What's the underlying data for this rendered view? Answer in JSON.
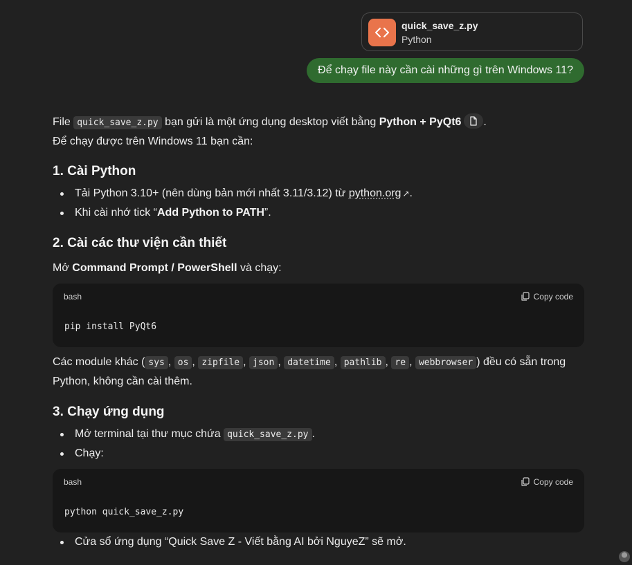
{
  "attachment": {
    "name": "quick_save_z.py",
    "type": "Python",
    "icon": "code-icon",
    "color": "#e9744b"
  },
  "user_message": "Để chạy file này cần cài những gì trên Windows 11?",
  "response": {
    "intro": {
      "p1_before": "File ",
      "p1_code": "quick_save_z.py",
      "p1_mid": " bạn gửi là một ứng dụng desktop viết bằng ",
      "p1_bold": "Python + PyQt6",
      "p1_after": ".",
      "p2": "Để chạy được trên Windows 11 bạn cần:"
    },
    "section1": {
      "title": "1. Cài Python",
      "item1_before": "Tải Python 3.10+ (nên dùng bản mới nhất 3.11/3.12) từ ",
      "item1_link": "python.org",
      "item1_arrow": "↗",
      "item1_after": ".",
      "item2_before": "Khi cài nhớ tick “",
      "item2_bold": "Add Python to PATH",
      "item2_after": "”."
    },
    "section2": {
      "title": "2. Cài các thư viện cần thiết",
      "intro_before": "Mở ",
      "intro_bold": "Command Prompt / PowerShell",
      "intro_after": " và chạy:",
      "code_lang": "bash",
      "code_copy": "Copy code",
      "code": "pip install PyQt6",
      "modules_before": "Các module khác (",
      "modules": [
        "sys",
        "os",
        "zipfile",
        "json",
        "datetime",
        "pathlib",
        "re",
        "webbrowser"
      ],
      "modules_after": ") đều có sẵn trong",
      "modules_line2": "Python, không cần cài thêm."
    },
    "section3": {
      "title": "3. Chạy ứng dụng",
      "item1_before": "Mở terminal tại thư mục chứa ",
      "item1_code": "quick_save_z.py",
      "item1_after": ".",
      "item2": "Chạy:",
      "code_lang": "bash",
      "code_copy": "Copy code",
      "code": "python quick_save_z.py",
      "item3": "Cửa sổ ứng dụng “Quick Save Z - Viết bằng AI bởi NguyeZ” sẽ mở."
    }
  }
}
